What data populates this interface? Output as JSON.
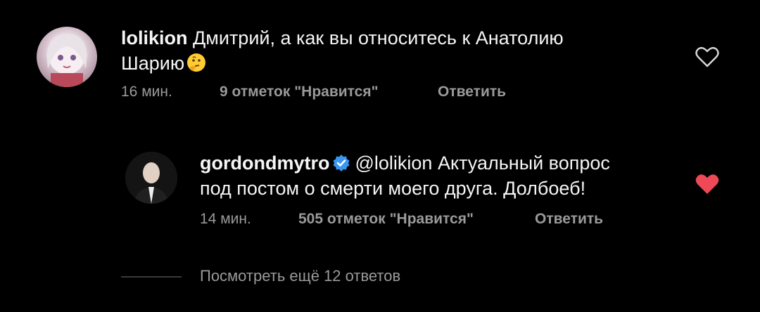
{
  "comments": [
    {
      "username": "lolikion",
      "text_line1": "Дмитрий, а как вы относитесь к Анатолию",
      "text_line2": "Шарию",
      "time": "16 мин.",
      "likes": "9 отметок \"Нравится\"",
      "reply": "Ответить",
      "liked": false
    },
    {
      "username": "gordondmytro",
      "mention": "@lolikion",
      "text_line1": "Актуальный вопрос",
      "text_line2": "под постом о смерти моего друга. Долбоеб!",
      "time": "14 мин.",
      "likes": "505 отметок \"Нравится\"",
      "reply": "Ответить",
      "liked": true
    }
  ],
  "view_more": "Посмотреть ещё 12 ответов",
  "colors": {
    "heart_liked": "#ed4956",
    "verified": "#3897f0",
    "muted": "#9a9a9a"
  }
}
